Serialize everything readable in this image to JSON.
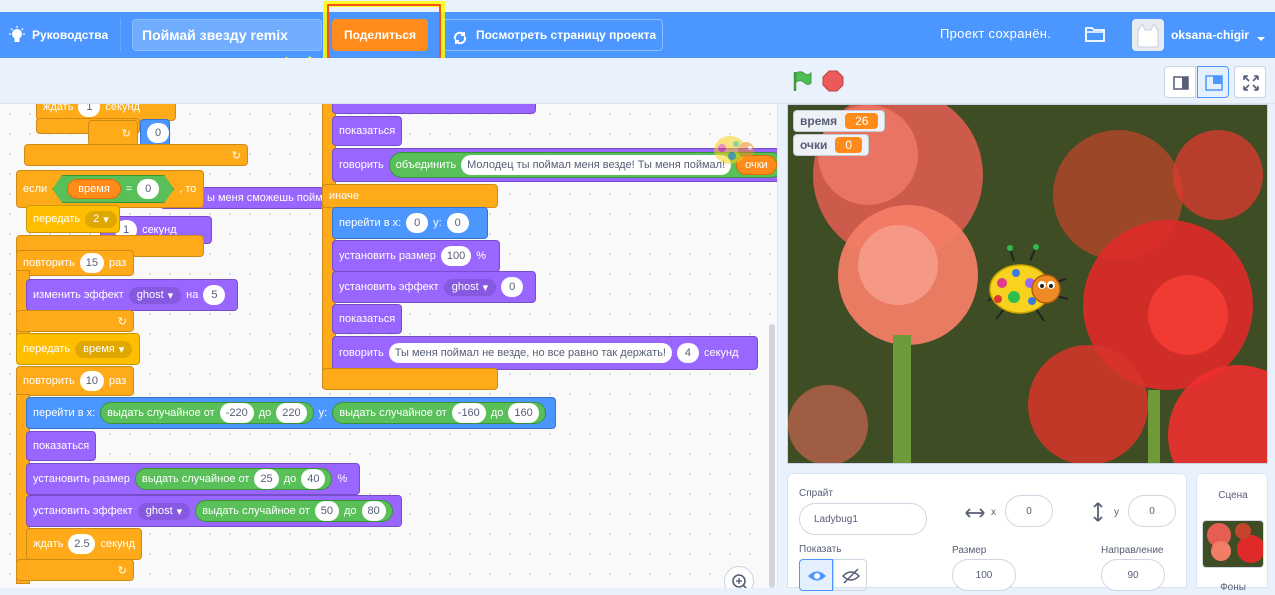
{
  "topbar": {
    "tutorials": "Руководства",
    "project_title": "Поймай звезду remix",
    "share": "Поделиться",
    "view_project": "Посмотреть страницу проекта",
    "saved": "Проект сохранён.",
    "username": "oksana-chigir"
  },
  "code": {
    "wait_1": "ждать",
    "wait_1_val": "1",
    "wait_1_unit": "секунд",
    "val_0a": "0",
    "if": "если",
    "var_time": "время",
    "eq": "=",
    "if_val": "0",
    "then": ", то",
    "send": "передать",
    "send_val": "2",
    "behind_text": "ы меня сможешь поймат",
    "behind_1": "1",
    "behind_sec": "секунд",
    "behind_bang": "!",
    "repeat15": "повторить",
    "repeat15_val": "15",
    "times": "раз",
    "change_effect": "изменить эффект",
    "ghost": "ghost",
    "by": "на",
    "change_val": "5",
    "send_time": "передать",
    "send_time_val": "время",
    "repeat10": "повторить",
    "repeat10_val": "10",
    "goto": "перейти в x:",
    "rand": "выдать случайное от",
    "to": "до",
    "rx1": "-220",
    "rx2": "220",
    "y_lbl": "y:",
    "ry1": "-160",
    "ry2": "160",
    "show": "показаться",
    "set_size": "установить размер",
    "rs1": "25",
    "rs2": "40",
    "pct": "%",
    "set_effect": "установить эффект",
    "re1": "50",
    "re2": "80",
    "wait_25": "ждать",
    "wait_25_val": "2.5",
    "sec": "секунд",
    "r_show1": "показаться",
    "r_say": "говорить",
    "r_join": "объединить",
    "r_join_text": "Молодец ты поймал меня везде! Ты меня поймал!",
    "r_points": "очки",
    "r_else": "иначе",
    "r_goto": "перейти в x:",
    "r_x": "0",
    "r_y_lbl": "y:",
    "r_y": "0",
    "r_size": "установить размер",
    "r_size_val": "100",
    "r_pct": "%",
    "r_effect": "установить эффект",
    "r_ghost": "ghost",
    "r_effect_val": "0",
    "r_show2": "показаться",
    "r_say2": "говорить",
    "r_say2_text": "Ты меня поймал не везде, но все равно так держать!",
    "r_say2_val": "4",
    "r_say2_unit": "секунд"
  },
  "stage": {
    "monitors": [
      {
        "label": "время",
        "value": "26"
      },
      {
        "label": "очки",
        "value": "0"
      }
    ]
  },
  "sprite": {
    "sprite_label": "Спрайт",
    "sprite_name": "Ladybug1",
    "x_label": "x",
    "x_val": "0",
    "y_label": "y",
    "y_val": "0",
    "show_label": "Показать",
    "size_label": "Размер",
    "size_val": "100",
    "dir_label": "Направление",
    "dir_val": "90"
  },
  "stage_panel": {
    "label": "Сцена",
    "backdrops": "Фоны"
  },
  "colors": {
    "menu_blue": "#4c97ff",
    "share_orange": "#ff8c1a",
    "annotation_yellow": "#ffff00"
  }
}
